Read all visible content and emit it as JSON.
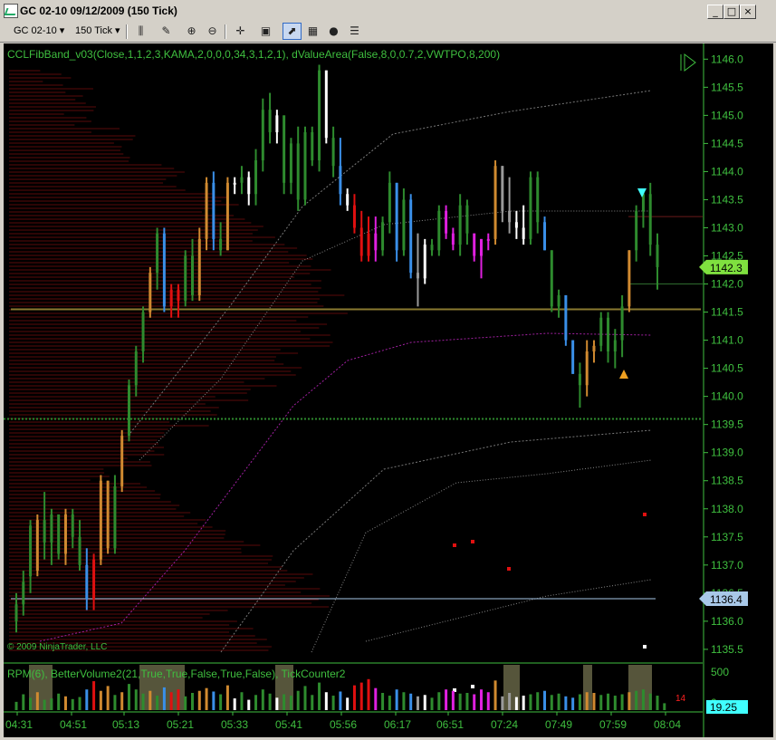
{
  "window": {
    "title": "GC 02-10  09/12/2009 (150 Tick)",
    "buttons": [
      "_",
      "□",
      "×"
    ]
  },
  "toolbar": {
    "instrument": "GC 02-10",
    "interval": "150 Tick",
    "icons": [
      "bar-type-icon",
      "draw-pencil-icon",
      "zoom-in-icon",
      "zoom-out-icon",
      "crosshair-icon",
      "window-fit-icon",
      "indicators-icon",
      "strategies-icon",
      "properties-icon",
      "data-box-icon"
    ]
  },
  "indicator_label": "CCLFibBand_v03(Close,1,1,2,3,KAMA,2,0,0,0,34,3,1,2,1), dValueArea(False,8,0,0.7,2,VWTPO,8,200)",
  "copyright": "© 2009 NinjaTrader, LLC",
  "lower_panel_label": "RPM(6), BetterVolume2(21,True,True,False,True,False), TickCounter2",
  "tick_counter": "14",
  "colors": {
    "up": "#2e8b2e",
    "up_strong": "#3fbf3f",
    "down_blue": "#3a8fe8",
    "orange": "#d08a30",
    "red": "#e01010",
    "white": "#ffffff",
    "magenta": "#e020e0",
    "gray": "#9a9a9a",
    "price_tag_green": "#7fe03f",
    "price_tag_blue": "#a8c8e8",
    "volume_tag": "#40ffff"
  },
  "chart_data": {
    "type": "candlestick",
    "price_axis": {
      "ylim": [
        1135.45,
        1146.15
      ],
      "ticks": [
        "1146.0",
        "1145.5",
        "1145.0",
        "1144.5",
        "1144.0",
        "1143.5",
        "1143.0",
        "1142.5",
        "1142.0",
        "1141.5",
        "1141.0",
        "1140.5",
        "1140.0",
        "1139.5",
        "1139.0",
        "1138.5",
        "1138.0",
        "1137.5",
        "1137.0",
        "1136.5",
        "1136.0",
        "1135.5"
      ]
    },
    "price_markers": [
      {
        "label": "1142.3",
        "value": 1142.3,
        "color": "price_tag_green"
      },
      {
        "label": "1136.4",
        "value": 1136.4,
        "color": "price_tag_blue"
      }
    ],
    "time_axis": [
      "04:31",
      "04:51",
      "05:13",
      "05:21",
      "05:33",
      "05:41",
      "05:56",
      "06:17",
      "06:51",
      "07:24",
      "07:49",
      "07:59",
      "08:04"
    ],
    "volume_axis": {
      "ticks": [
        "500",
        "0"
      ],
      "marker": "19.25"
    },
    "bars": [
      {
        "o": 1136.0,
        "h": 1136.5,
        "l": 1135.8,
        "c": 1136.3,
        "k": "up"
      },
      {
        "o": 1136.3,
        "h": 1136.9,
        "l": 1136.1,
        "c": 1136.7,
        "k": "up"
      },
      {
        "o": 1136.8,
        "h": 1137.8,
        "l": 1136.5,
        "c": 1137.7,
        "k": "up"
      },
      {
        "o": 1136.9,
        "h": 1137.9,
        "l": 1136.8,
        "c": 1137.8,
        "k": "orange"
      },
      {
        "o": 1137.8,
        "h": 1138.3,
        "l": 1137.1,
        "c": 1137.4,
        "k": "up"
      },
      {
        "o": 1137.4,
        "h": 1138.0,
        "l": 1137.0,
        "c": 1137.9,
        "k": "up"
      },
      {
        "o": 1137.9,
        "h": 1137.9,
        "l": 1137.1,
        "c": 1137.2,
        "k": "up"
      },
      {
        "o": 1137.2,
        "h": 1138.0,
        "l": 1137.0,
        "c": 1137.9,
        "k": "orange"
      },
      {
        "o": 1137.9,
        "h": 1138.0,
        "l": 1137.3,
        "c": 1137.5,
        "k": "up"
      },
      {
        "o": 1137.5,
        "h": 1137.8,
        "l": 1136.9,
        "c": 1137.0,
        "k": "up"
      },
      {
        "o": 1137.0,
        "h": 1137.3,
        "l": 1136.2,
        "c": 1136.4,
        "k": "down_blue"
      },
      {
        "o": 1136.4,
        "h": 1137.2,
        "l": 1136.2,
        "c": 1137.1,
        "k": "red"
      },
      {
        "o": 1137.1,
        "h": 1138.6,
        "l": 1137.0,
        "c": 1138.5,
        "k": "orange"
      },
      {
        "o": 1138.5,
        "h": 1138.5,
        "l": 1137.2,
        "c": 1137.3,
        "k": "orange"
      },
      {
        "o": 1137.3,
        "h": 1138.6,
        "l": 1137.2,
        "c": 1138.4,
        "k": "up"
      },
      {
        "o": 1138.4,
        "h": 1139.4,
        "l": 1138.3,
        "c": 1139.3,
        "k": "orange"
      },
      {
        "o": 1139.3,
        "h": 1140.3,
        "l": 1139.2,
        "c": 1140.2,
        "k": "up"
      },
      {
        "o": 1140.2,
        "h": 1140.9,
        "l": 1140.0,
        "c": 1140.8,
        "k": "up"
      },
      {
        "o": 1140.8,
        "h": 1141.6,
        "l": 1140.6,
        "c": 1141.5,
        "k": "up"
      },
      {
        "o": 1141.5,
        "h": 1142.3,
        "l": 1141.4,
        "c": 1142.2,
        "k": "orange"
      },
      {
        "o": 1142.2,
        "h": 1143.0,
        "l": 1141.9,
        "c": 1142.9,
        "k": "up"
      },
      {
        "o": 1142.9,
        "h": 1143.0,
        "l": 1141.5,
        "c": 1141.6,
        "k": "down_blue"
      },
      {
        "o": 1141.6,
        "h": 1142.0,
        "l": 1141.4,
        "c": 1141.9,
        "k": "red"
      },
      {
        "o": 1141.9,
        "h": 1142.0,
        "l": 1141.4,
        "c": 1141.7,
        "k": "red"
      },
      {
        "o": 1141.7,
        "h": 1142.6,
        "l": 1141.6,
        "c": 1142.5,
        "k": "up"
      },
      {
        "o": 1142.5,
        "h": 1142.8,
        "l": 1141.7,
        "c": 1141.8,
        "k": "up"
      },
      {
        "o": 1141.8,
        "h": 1143.0,
        "l": 1141.7,
        "c": 1142.8,
        "k": "orange"
      },
      {
        "o": 1142.8,
        "h": 1143.9,
        "l": 1142.6,
        "c": 1143.8,
        "k": "orange"
      },
      {
        "o": 1143.8,
        "h": 1144.0,
        "l": 1142.6,
        "c": 1142.8,
        "k": "down_blue"
      },
      {
        "o": 1142.8,
        "h": 1143.1,
        "l": 1142.5,
        "c": 1142.6,
        "k": "up"
      },
      {
        "o": 1142.6,
        "h": 1143.9,
        "l": 1142.6,
        "c": 1143.8,
        "k": "orange"
      },
      {
        "o": 1143.8,
        "h": 1143.9,
        "l": 1143.6,
        "c": 1143.8,
        "k": "white"
      },
      {
        "o": 1143.8,
        "h": 1144.1,
        "l": 1143.6,
        "c": 1143.9,
        "k": "up"
      },
      {
        "o": 1143.9,
        "h": 1144.0,
        "l": 1143.4,
        "c": 1143.6,
        "k": "white"
      },
      {
        "o": 1143.6,
        "h": 1144.4,
        "l": 1143.4,
        "c": 1144.2,
        "k": "up"
      },
      {
        "o": 1144.2,
        "h": 1145.3,
        "l": 1144.0,
        "c": 1145.1,
        "k": "up"
      },
      {
        "o": 1145.1,
        "h": 1145.4,
        "l": 1144.5,
        "c": 1144.7,
        "k": "up"
      },
      {
        "o": 1144.7,
        "h": 1145.1,
        "l": 1144.5,
        "c": 1145.0,
        "k": "white"
      },
      {
        "o": 1145.0,
        "h": 1145.0,
        "l": 1143.6,
        "c": 1143.8,
        "k": "up"
      },
      {
        "o": 1143.8,
        "h": 1144.6,
        "l": 1143.6,
        "c": 1144.5,
        "k": "up"
      },
      {
        "o": 1144.5,
        "h": 1144.8,
        "l": 1143.3,
        "c": 1143.5,
        "k": "up"
      },
      {
        "o": 1143.5,
        "h": 1144.8,
        "l": 1143.4,
        "c": 1144.7,
        "k": "up"
      },
      {
        "o": 1144.7,
        "h": 1144.8,
        "l": 1144.1,
        "c": 1144.2,
        "k": "up"
      },
      {
        "o": 1144.2,
        "h": 1145.9,
        "l": 1144.0,
        "c": 1145.8,
        "k": "up"
      },
      {
        "o": 1145.8,
        "h": 1145.8,
        "l": 1144.5,
        "c": 1144.6,
        "k": "white"
      },
      {
        "o": 1144.6,
        "h": 1144.8,
        "l": 1143.9,
        "c": 1144.1,
        "k": "up"
      },
      {
        "o": 1144.1,
        "h": 1144.6,
        "l": 1143.4,
        "c": 1143.6,
        "k": "down_blue"
      },
      {
        "o": 1143.6,
        "h": 1143.7,
        "l": 1143.3,
        "c": 1143.4,
        "k": "white"
      },
      {
        "o": 1143.4,
        "h": 1143.6,
        "l": 1142.9,
        "c": 1143.0,
        "k": "red"
      },
      {
        "o": 1143.0,
        "h": 1143.3,
        "l": 1142.4,
        "c": 1142.5,
        "k": "red"
      },
      {
        "o": 1142.5,
        "h": 1143.2,
        "l": 1142.4,
        "c": 1142.9,
        "k": "red"
      },
      {
        "o": 1142.9,
        "h": 1143.2,
        "l": 1142.4,
        "c": 1142.6,
        "k": "magenta"
      },
      {
        "o": 1142.6,
        "h": 1143.2,
        "l": 1142.5,
        "c": 1143.1,
        "k": "up"
      },
      {
        "o": 1143.1,
        "h": 1144.0,
        "l": 1142.9,
        "c": 1143.8,
        "k": "up"
      },
      {
        "o": 1143.8,
        "h": 1143.8,
        "l": 1142.4,
        "c": 1142.6,
        "k": "down_blue"
      },
      {
        "o": 1142.6,
        "h": 1143.7,
        "l": 1142.5,
        "c": 1143.5,
        "k": "up"
      },
      {
        "o": 1143.5,
        "h": 1143.6,
        "l": 1142.1,
        "c": 1142.2,
        "k": "down_blue"
      },
      {
        "o": 1142.2,
        "h": 1142.9,
        "l": 1141.6,
        "c": 1142.1,
        "k": "gray"
      },
      {
        "o": 1142.1,
        "h": 1142.8,
        "l": 1142.0,
        "c": 1142.7,
        "k": "white"
      },
      {
        "o": 1142.7,
        "h": 1142.8,
        "l": 1142.5,
        "c": 1142.6,
        "k": "up"
      },
      {
        "o": 1142.6,
        "h": 1143.4,
        "l": 1142.5,
        "c": 1143.3,
        "k": "up"
      },
      {
        "o": 1143.3,
        "h": 1143.4,
        "l": 1142.8,
        "c": 1142.9,
        "k": "magenta"
      },
      {
        "o": 1142.9,
        "h": 1143.0,
        "l": 1142.6,
        "c": 1142.7,
        "k": "magenta"
      },
      {
        "o": 1142.7,
        "h": 1143.6,
        "l": 1142.5,
        "c": 1143.4,
        "k": "up"
      },
      {
        "o": 1143.4,
        "h": 1143.5,
        "l": 1142.7,
        "c": 1142.9,
        "k": "up"
      },
      {
        "o": 1142.9,
        "h": 1142.9,
        "l": 1142.4,
        "c": 1142.5,
        "k": "magenta"
      },
      {
        "o": 1142.5,
        "h": 1142.8,
        "l": 1142.1,
        "c": 1142.8,
        "k": "magenta"
      },
      {
        "o": 1142.8,
        "h": 1142.9,
        "l": 1142.6,
        "c": 1142.8,
        "k": "magenta"
      },
      {
        "o": 1142.8,
        "h": 1144.2,
        "l": 1142.7,
        "c": 1144.1,
        "k": "orange"
      },
      {
        "o": 1144.1,
        "h": 1144.1,
        "l": 1143.1,
        "c": 1143.3,
        "k": "gray"
      },
      {
        "o": 1143.3,
        "h": 1143.9,
        "l": 1142.9,
        "c": 1143.1,
        "k": "gray"
      },
      {
        "o": 1143.1,
        "h": 1143.3,
        "l": 1142.8,
        "c": 1143.0,
        "k": "white"
      },
      {
        "o": 1143.0,
        "h": 1143.4,
        "l": 1142.7,
        "c": 1142.8,
        "k": "white"
      },
      {
        "o": 1142.8,
        "h": 1144.0,
        "l": 1142.7,
        "c": 1143.9,
        "k": "up"
      },
      {
        "o": 1143.9,
        "h": 1144.0,
        "l": 1142.9,
        "c": 1143.1,
        "k": "up"
      },
      {
        "o": 1143.1,
        "h": 1143.2,
        "l": 1142.6,
        "c": 1142.6,
        "k": "down_blue"
      },
      {
        "o": 1142.6,
        "h": 1142.6,
        "l": 1141.5,
        "c": 1141.6,
        "k": "up"
      },
      {
        "o": 1141.6,
        "h": 1141.9,
        "l": 1141.4,
        "c": 1141.8,
        "k": "up"
      },
      {
        "o": 1141.8,
        "h": 1141.8,
        "l": 1140.9,
        "c": 1141.0,
        "k": "down_blue"
      },
      {
        "o": 1141.0,
        "h": 1141.0,
        "l": 1140.4,
        "c": 1140.4,
        "k": "down_blue"
      },
      {
        "o": 1140.4,
        "h": 1140.6,
        "l": 1139.8,
        "c": 1140.2,
        "k": "up"
      },
      {
        "o": 1140.2,
        "h": 1141.0,
        "l": 1140.0,
        "c": 1140.8,
        "k": "orange"
      },
      {
        "o": 1140.8,
        "h": 1141.0,
        "l": 1140.6,
        "c": 1140.9,
        "k": "orange"
      },
      {
        "o": 1140.9,
        "h": 1141.5,
        "l": 1140.8,
        "c": 1141.4,
        "k": "up"
      },
      {
        "o": 1141.4,
        "h": 1141.5,
        "l": 1140.6,
        "c": 1140.8,
        "k": "up"
      },
      {
        "o": 1140.8,
        "h": 1141.2,
        "l": 1140.5,
        "c": 1141.0,
        "k": "up"
      },
      {
        "o": 1141.0,
        "h": 1141.8,
        "l": 1140.7,
        "c": 1141.6,
        "k": "up"
      },
      {
        "o": 1141.6,
        "h": 1142.6,
        "l": 1141.5,
        "c": 1142.6,
        "k": "orange"
      },
      {
        "o": 1142.6,
        "h": 1143.4,
        "l": 1142.4,
        "c": 1143.3,
        "k": "up"
      },
      {
        "o": 1143.3,
        "h": 1143.7,
        "l": 1143.0,
        "c": 1143.6,
        "k": "up"
      },
      {
        "o": 1143.6,
        "h": 1143.8,
        "l": 1142.5,
        "c": 1142.7,
        "k": "up"
      },
      {
        "o": 1142.7,
        "h": 1142.9,
        "l": 1141.9,
        "c": 1142.3,
        "k": "up"
      }
    ],
    "volume": [
      120,
      230,
      180,
      260,
      150,
      170,
      240,
      200,
      160,
      190,
      300,
      420,
      280,
      350,
      220,
      260,
      380,
      300,
      240,
      280,
      210,
      330,
      260,
      300,
      200,
      250,
      280,
      320,
      270,
      230,
      360,
      170,
      260,
      150,
      220,
      300,
      240,
      180,
      230,
      210,
      280,
      350,
      220,
      400,
      260,
      210,
      270,
      180,
      360,
      400,
      450,
      320,
      250,
      210,
      300,
      260,
      240,
      200,
      220,
      180,
      260,
      300,
      280,
      240,
      250,
      230,
      300,
      260,
      430,
      200,
      250,
      190,
      210,
      230,
      260,
      280,
      220,
      240,
      200,
      180,
      230,
      260,
      250,
      220,
      240,
      210,
      230,
      260,
      280,
      300,
      240,
      210,
      100
    ]
  }
}
